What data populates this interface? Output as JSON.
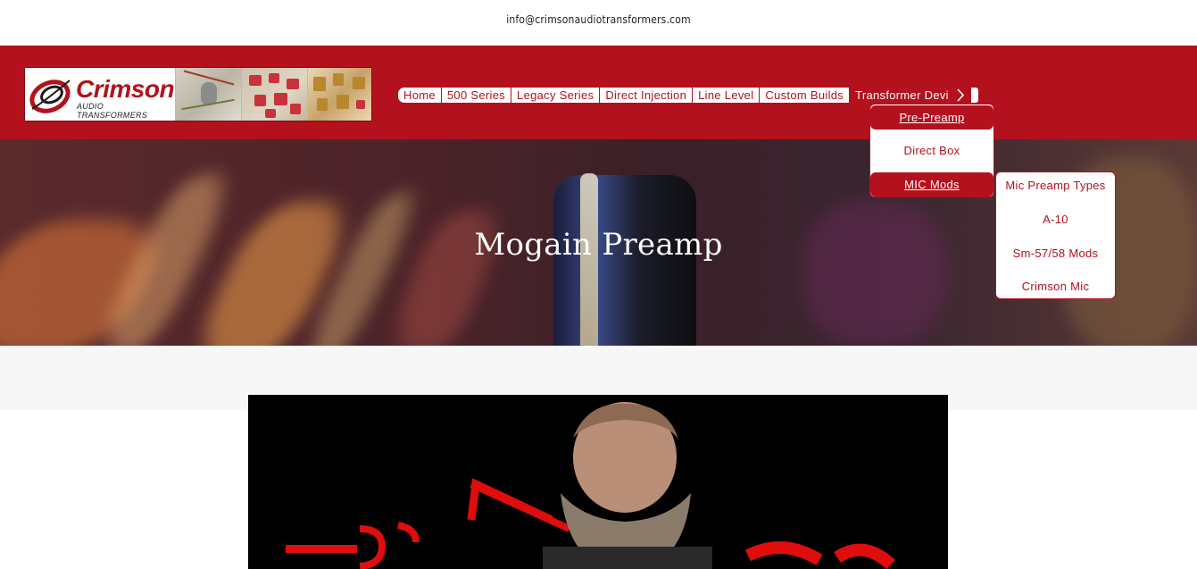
{
  "topbar": {
    "email": "info@crimsonaudiotransformers.com"
  },
  "logo": {
    "name": "Crimson",
    "subtitle": "Audio Transformers"
  },
  "nav": {
    "items": [
      {
        "label": "Home"
      },
      {
        "label": "500 Series"
      },
      {
        "label": "Legacy Series"
      },
      {
        "label": "Direct Injection"
      },
      {
        "label": "Line Level"
      },
      {
        "label": "Custom Builds"
      },
      {
        "label": "Transformer Devi"
      }
    ],
    "next_icon": "chevron-right-icon"
  },
  "dropdown": {
    "items": [
      {
        "label": "Pre-Preamp"
      },
      {
        "label": "Direct Box"
      },
      {
        "label": "MIC Mods"
      }
    ]
  },
  "submenu": {
    "items": [
      {
        "label": "Mic Preamp Types"
      },
      {
        "label": "A-10"
      },
      {
        "label": "Sm-57/58 Mods"
      },
      {
        "label": "Crimson Mic"
      }
    ]
  },
  "hero": {
    "title": "Mogain Preamp"
  },
  "colors": {
    "brand": "#b2111d",
    "band": "#f7f7f7"
  }
}
